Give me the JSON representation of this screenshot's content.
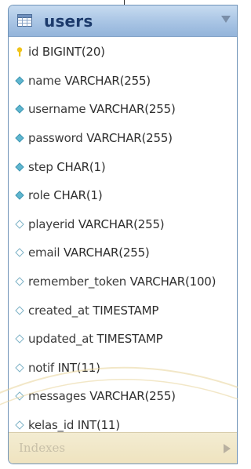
{
  "table": {
    "name": "users",
    "columns": [
      {
        "name": "id",
        "type": "BIGINT(20)",
        "icon": "primary-key-icon",
        "kind": "key"
      },
      {
        "name": "name",
        "type": "VARCHAR(255)",
        "icon": "diamond-filled-icon",
        "kind": "required"
      },
      {
        "name": "username",
        "type": "VARCHAR(255)",
        "icon": "diamond-filled-icon",
        "kind": "required"
      },
      {
        "name": "password",
        "type": "VARCHAR(255)",
        "icon": "diamond-filled-icon",
        "kind": "required"
      },
      {
        "name": "step",
        "type": "CHAR(1)",
        "icon": "diamond-filled-icon",
        "kind": "required"
      },
      {
        "name": "role",
        "type": "CHAR(1)",
        "icon": "diamond-filled-icon",
        "kind": "required"
      },
      {
        "name": "playerid",
        "type": "VARCHAR(255)",
        "icon": "diamond-outline-icon",
        "kind": "nullable"
      },
      {
        "name": "email",
        "type": "VARCHAR(255)",
        "icon": "diamond-outline-icon",
        "kind": "nullable"
      },
      {
        "name": "remember_token",
        "type": "VARCHAR(100)",
        "icon": "diamond-outline-icon",
        "kind": "nullable"
      },
      {
        "name": "created_at",
        "type": "TIMESTAMP",
        "icon": "diamond-outline-icon",
        "kind": "nullable"
      },
      {
        "name": "updated_at",
        "type": "TIMESTAMP",
        "icon": "diamond-outline-icon",
        "kind": "nullable"
      },
      {
        "name": "notif",
        "type": "INT(11)",
        "icon": "diamond-outline-icon",
        "kind": "nullable"
      },
      {
        "name": "messages",
        "type": "VARCHAR(255)",
        "icon": "diamond-outline-icon",
        "kind": "nullable"
      },
      {
        "name": "kelas_id",
        "type": "INT(11)",
        "icon": "diamond-outline-icon",
        "kind": "nullable"
      }
    ],
    "indexes_label": "Indexes"
  },
  "colors": {
    "header_top": "#c7dbf0",
    "header_bottom": "#93b4da",
    "title_text": "#1c3a6b",
    "diamond_fill": "#5fb6cf",
    "key_icon": "#f0c419",
    "indexes_bg": "#efe3bf"
  },
  "icons": {
    "table": "table-grid-icon",
    "collapse": "triangle-down-icon",
    "indexes_expand": "triangle-right-icon"
  }
}
